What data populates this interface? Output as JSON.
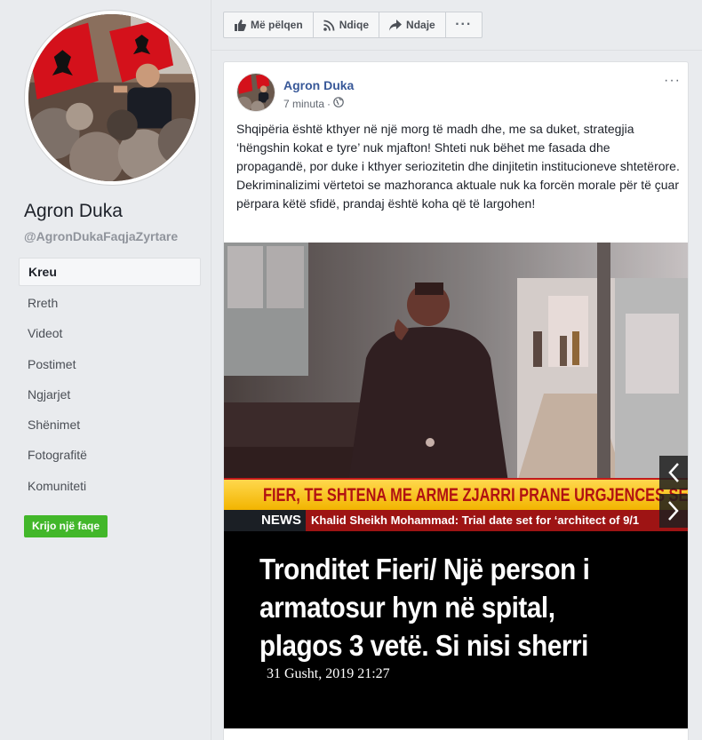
{
  "page": {
    "name": "Agron Duka",
    "handle": "@AgronDukaFaqjaZyrtare",
    "create_page_label": "Krijo një faqe"
  },
  "nav": {
    "items": [
      {
        "label": "Kreu",
        "active": true
      },
      {
        "label": "Rreth"
      },
      {
        "label": "Videot"
      },
      {
        "label": "Postimet"
      },
      {
        "label": "Ngjarjet"
      },
      {
        "label": "Shënimet"
      },
      {
        "label": "Fotografitë"
      },
      {
        "label": "Komuniteti"
      }
    ]
  },
  "actions": {
    "like": "Më pëlqen",
    "follow": "Ndiqe",
    "share": "Ndaje",
    "more": "···"
  },
  "post": {
    "author": "Agron Duka",
    "time": "7 minuta",
    "privacy_icon": "globe-icon",
    "menu": "···",
    "text": "Shqipëria është kthyer në një morg të madh dhe, me sa duket, strategjia ‘hëngshin kokat e tyre’ nuk mjafton! Shteti nuk bëhet me fasada dhe propagandë, por duke i kthyer seriozitetin dhe dinjitetin institucioneve shtetërore. Dekriminalizimi vërtetoi se mazhoranca aktuale nuk ka forcën morale për të çuar përpara këtë sfidë, prandaj është koha që të largohen!",
    "image": {
      "ticker_headline": "FIER, TE SHTENA ME ARME ZJARRI PRANE URGJENCES SE SPITA",
      "news_label": "NEWS",
      "news_ticker": "Khalid Sheikh Mohammad: Trial date set for ‘architect of 9/1",
      "headline_lines": [
        "Tronditet Fieri/ Një person i",
        "armatosur hyn në spital,",
        "plagos 3 vetë. Si nisi sherri"
      ],
      "date": "31 Gusht, 2019 21:27"
    }
  },
  "colors": {
    "link": "#385898",
    "button_green": "#42b72a",
    "background": "#e9ebee"
  }
}
